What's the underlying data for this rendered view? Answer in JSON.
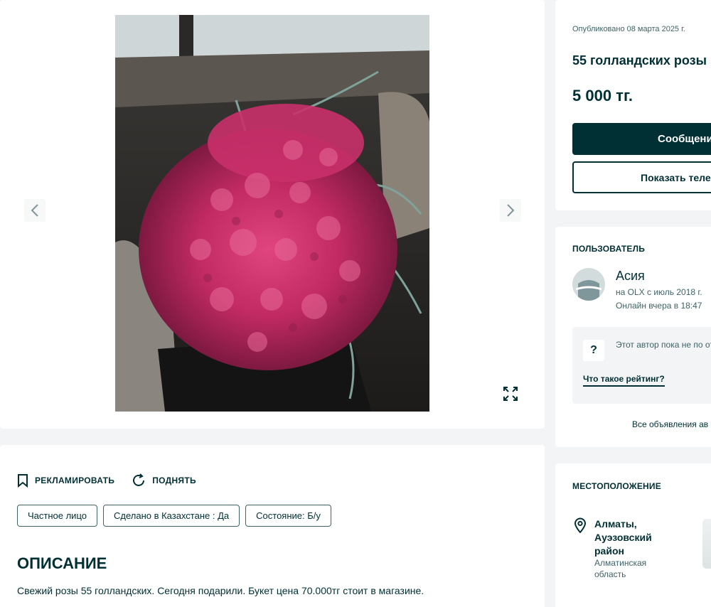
{
  "gallery": {
    "prev_icon": "chevron-left-icon",
    "next_icon": "chevron-right-icon",
    "fullscreen_icon": "expand-icon"
  },
  "actions": {
    "promote_label": "РЕКЛАМИРОВАТЬ",
    "raise_label": "ПОДНЯТЬ"
  },
  "tags": [
    "Частное лицо",
    "Сделано в Казахстане : Да",
    "Состояние: Б/у"
  ],
  "description": {
    "title": "ОПИСАНИЕ",
    "text": "Свежий розы 55 голландских. Сегодня подарили. Букет цена 70.000тг стоит в магазине."
  },
  "ad": {
    "published": "Опубликовано 08 марта 2025 г.",
    "title": "55 голландских розы",
    "price": "5 000 тг.",
    "message_button": "Сообщени",
    "phone_button": "Показать теле"
  },
  "user": {
    "section_title": "ПОЛЬЗОВАТЕЛЬ",
    "name": "Асия",
    "member_since": "на OLX с июль 2018 г.",
    "last_online": "Онлайн вчера в 18:47",
    "rating_text": "Этот автор пока не по отзыва",
    "rating_link": "Что такое рейтинг?",
    "all_ads_link": "Все объявления ав"
  },
  "location": {
    "section_title": "МЕСТОПОЛОЖЕНИЕ",
    "city": "Алматы, Ауэзовский район",
    "region": "Алматинская область"
  },
  "colors": {
    "brand_dark": "#002f34",
    "page_background": "#f2f4f5",
    "secondary_text": "#406367"
  }
}
